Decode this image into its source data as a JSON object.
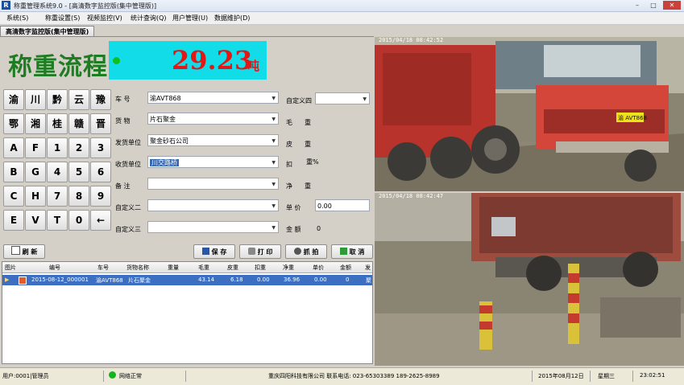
{
  "window": {
    "title": "称重管理系统9.0 - [高清数字监控版(集中管理版)]",
    "controls": [
      "–",
      "□",
      "✕"
    ]
  },
  "menu": [
    "系统(S)",
    "称重设置(S)",
    "视频监控(V)",
    "统计查询(Q)",
    "用户管理(U)",
    "数据维护(D)"
  ],
  "tab": {
    "label": "高清数字监控版(集中管理版)"
  },
  "weighing": {
    "title": "称重流程",
    "weight": "29.23",
    "unit": "吨"
  },
  "keypad": {
    "rows": [
      [
        "渝",
        "川",
        "黔",
        "云",
        "豫"
      ],
      [
        "鄂",
        "湘",
        "桂",
        "赣",
        "晋"
      ],
      [
        "A",
        "F",
        "1",
        "2",
        "3"
      ],
      [
        "B",
        "G",
        "4",
        "5",
        "6"
      ],
      [
        "C",
        "H",
        "7",
        "8",
        "9"
      ],
      [
        "E",
        "V",
        "T",
        "0",
        "←"
      ]
    ]
  },
  "form": {
    "plate_label": "车  号",
    "plate_value": "渝AVT868",
    "goods_label": "货  物",
    "goods_value": "片石聚金",
    "shipper_label": "发货单位",
    "shipper_value": "聚金砂石公司",
    "receiver_label": "收货单位",
    "receiver_value": "川交路桥",
    "remark_label": "备  注",
    "remark_value": "",
    "custom2_label": "自定义二",
    "custom2_value": "",
    "custom3_label": "自定义三",
    "custom3_value": "",
    "custom4_label": "自定义四",
    "custom4_value": "",
    "gross_label": "毛",
    "gross_value": "重",
    "tare_label": "皮",
    "tare_value": "重",
    "deduct_label": "扣",
    "deduct_value": "重%",
    "net_label": "净",
    "net_value": "重",
    "price_label": "单  价",
    "price_value": "0.00",
    "amount_label": "金  额",
    "amount_value": "0"
  },
  "buttons": {
    "refresh": "刷  新",
    "save": "保  存",
    "print": "打  印",
    "capture": "抓  拍",
    "cancel": "取  消"
  },
  "table": {
    "columns": [
      "图片",
      "编号",
      "车号",
      "货物名称",
      "重量",
      "毛重",
      "皮重",
      "扣重",
      "净重",
      "单价",
      "金额",
      "发"
    ],
    "rows": [
      [
        "",
        "2015-08-12_000001",
        "渝AVT868",
        "片石聚金",
        "",
        "43.14",
        "6.18",
        "0.00",
        "36.96",
        "0.00",
        "0",
        "聚"
      ]
    ]
  },
  "cameras": {
    "cam1_timestamp": "2015/04/18 08:42:52",
    "cam2_timestamp": "2015/04/18 08:42:47",
    "plate_text": "渝 AVT868"
  },
  "status": {
    "user": "用户:0001|管理员",
    "network": "网络正常",
    "company": "重庆四阳科技有限公司  联系电话: 023-65303389  189-2625-8989",
    "date": "2015年08月12日",
    "weekday": "星期三",
    "time": "23:02:51"
  },
  "colors": {
    "flow_title": "#1e7d22",
    "weight_panel": "#12dce8",
    "weight_text": "#e01818",
    "selected_row": "#3c6fc1"
  }
}
